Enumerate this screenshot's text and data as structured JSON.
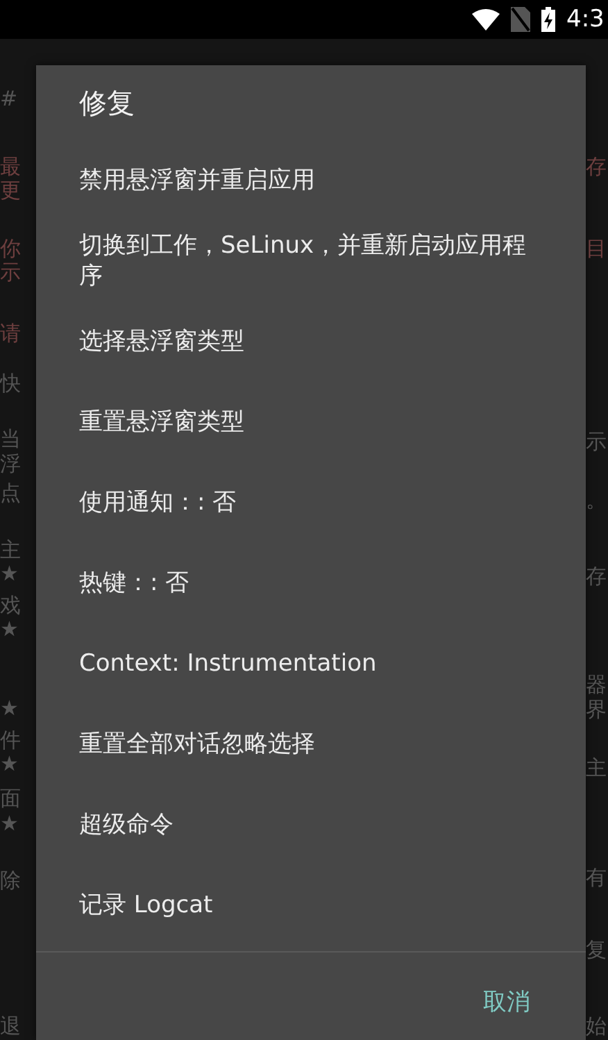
{
  "status_bar": {
    "time": "4:3"
  },
  "background": {
    "left": [
      {
        "text": "#",
        "color": "#555555"
      },
      {
        "text": "最",
        "color": "#6e3f3f"
      },
      {
        "text": "更",
        "color": "#6e3f3f"
      },
      {
        "text": "你",
        "color": "#6e3f3f"
      },
      {
        "text": "示",
        "color": "#6e3f3f"
      },
      {
        "text": "请",
        "color": "#6e3f3f"
      },
      {
        "text": "快",
        "color": "#555555"
      },
      {
        "text": "当",
        "color": "#555555"
      },
      {
        "text": "浮",
        "color": "#555555"
      },
      {
        "text": "点",
        "color": "#555555"
      },
      {
        "text": "主",
        "color": "#555555"
      },
      {
        "text": "★",
        "color": "#555555"
      },
      {
        "text": "戏",
        "color": "#555555"
      },
      {
        "text": "★",
        "color": "#555555"
      },
      {
        "text": "★",
        "color": "#555555"
      },
      {
        "text": "件",
        "color": "#555555"
      },
      {
        "text": "★",
        "color": "#555555"
      },
      {
        "text": "面",
        "color": "#555555"
      },
      {
        "text": "★",
        "color": "#555555"
      },
      {
        "text": "除",
        "color": "#555555"
      },
      {
        "text": "退",
        "color": "#555555"
      }
    ],
    "right": [
      {
        "text": "存",
        "color": "#6e3f3f"
      },
      {
        "text": "目",
        "color": "#6e3f3f"
      },
      {
        "text": "示",
        "color": "#555555"
      },
      {
        "text": "。",
        "color": "#555555"
      },
      {
        "text": "存",
        "color": "#555555"
      },
      {
        "text": "器",
        "color": "#555555"
      },
      {
        "text": "界",
        "color": "#555555"
      },
      {
        "text": "主",
        "color": "#555555"
      },
      {
        "text": "有",
        "color": "#555555"
      },
      {
        "text": "复",
        "color": "#555555"
      },
      {
        "text": "始",
        "color": "#555555"
      }
    ]
  },
  "dialog": {
    "title": "修复",
    "items": [
      "禁用悬浮窗并重启应用",
      "切换到工作，SeLinux，并重新启动应用程序",
      "选择悬浮窗类型",
      "重置悬浮窗类型",
      "使用通知：: 否",
      "热键：: 否",
      "Context: Instrumentation",
      "重置全部对话忽略选择",
      "超级命令",
      "记录 Logcat"
    ],
    "cancel": "取消"
  }
}
